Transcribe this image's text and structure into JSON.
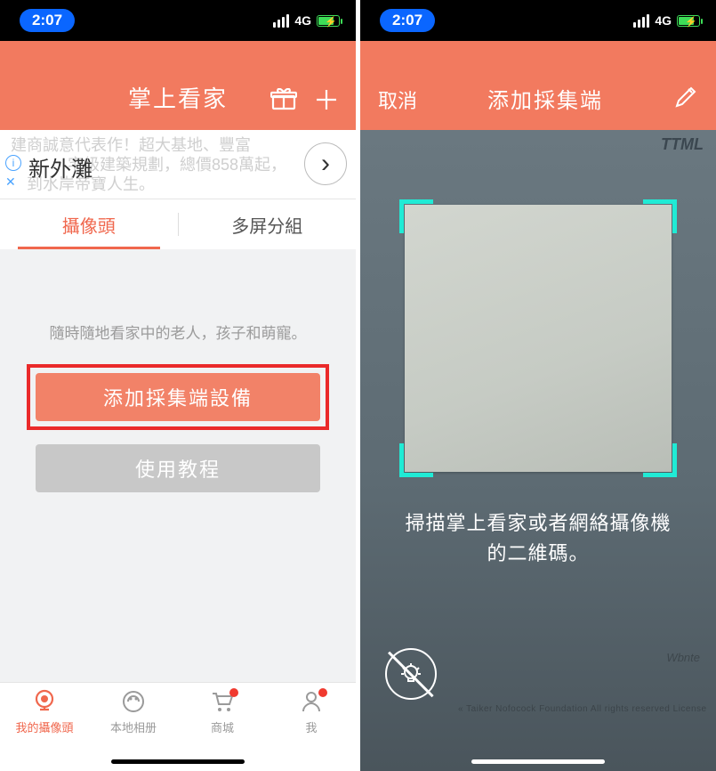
{
  "statusbar": {
    "time": "2:07",
    "network": "4G"
  },
  "left": {
    "header": {
      "title": "掌上看家"
    },
    "ad": {
      "line1": "建商誠意代表作！超大基地、豐富",
      "line2": "宅級建築規劃，總價858萬起，",
      "line3": "到水岸帝寶人生。",
      "highlight": "新外灘"
    },
    "tabs": {
      "camera": "攝像頭",
      "group": "多屏分組"
    },
    "content": {
      "subtitle": "隨時隨地看家中的老人，孩子和萌寵。",
      "add_device": "添加採集端設備",
      "tutorial": "使用教程"
    },
    "tabbar": {
      "my_camera": "我的攝像頭",
      "local_album": "本地相册",
      "store": "商城",
      "me": "我"
    }
  },
  "right": {
    "header": {
      "cancel": "取消",
      "title": "添加採集端"
    },
    "ttml": "TTML",
    "scan_text_l1": "掃描掌上看家或者網絡攝像機",
    "scan_text_l2": "的二維碼。",
    "wmark": "Wbnte",
    "blur": "« Taiker Nofocock Foundation  All rights reserved  Licensed under the GPL"
  }
}
